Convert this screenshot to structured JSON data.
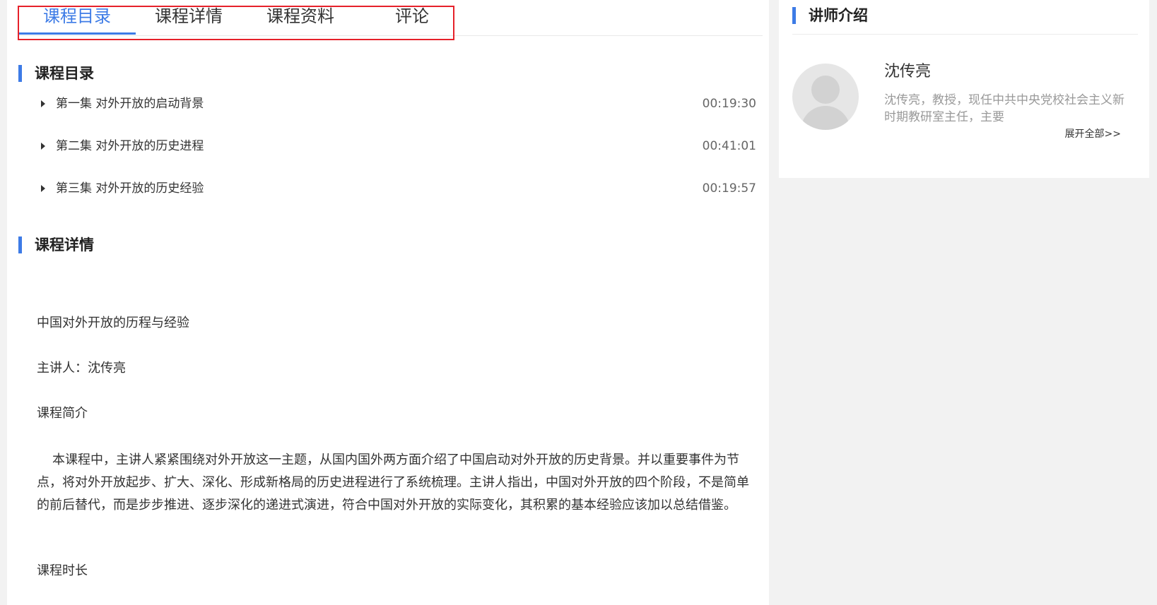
{
  "tabs": [
    {
      "label": "课程目录"
    },
    {
      "label": "课程详情"
    },
    {
      "label": "课程资料"
    },
    {
      "label": "评论"
    }
  ],
  "catalog": {
    "heading": "课程目录",
    "lessons": [
      {
        "title": "第一集 对外开放的启动背景",
        "duration": "00:19:30"
      },
      {
        "title": "第二集 对外开放的历史进程",
        "duration": "00:41:01"
      },
      {
        "title": "第三集 对外开放的历史经验",
        "duration": "00:19:57"
      }
    ]
  },
  "details": {
    "heading": "课程详情",
    "course_name": "中国对外开放的历程与经验",
    "presenter": "主讲人：沈传亮",
    "intro_label": "课程简介",
    "intro_text": "本课程中，主讲人紧紧围绕对外开放这一主题，从国内国外两方面介绍了中国启动对外开放的历史背景。并以重要事件为节点，将对外开放起步、扩大、深化、形成新格局的历史进程进行了系统梳理。主讲人指出，中国对外开放的四个阶段，不是简单的前后替代，而是步步推进、逐步深化的递进式演进，符合中国对外开放的实际变化，其积累的基本经验应该加以总结借鉴。",
    "duration_label": "课程时长"
  },
  "teacher": {
    "heading": "讲师介绍",
    "name": "沈传亮",
    "bio": "沈传亮，教授，现任中共中央党校社会主义新时期教研室主任，主要",
    "expand_label": "展开全部>>"
  },
  "colors": {
    "accent": "#3d7be6",
    "highlight": "#e6212a"
  }
}
